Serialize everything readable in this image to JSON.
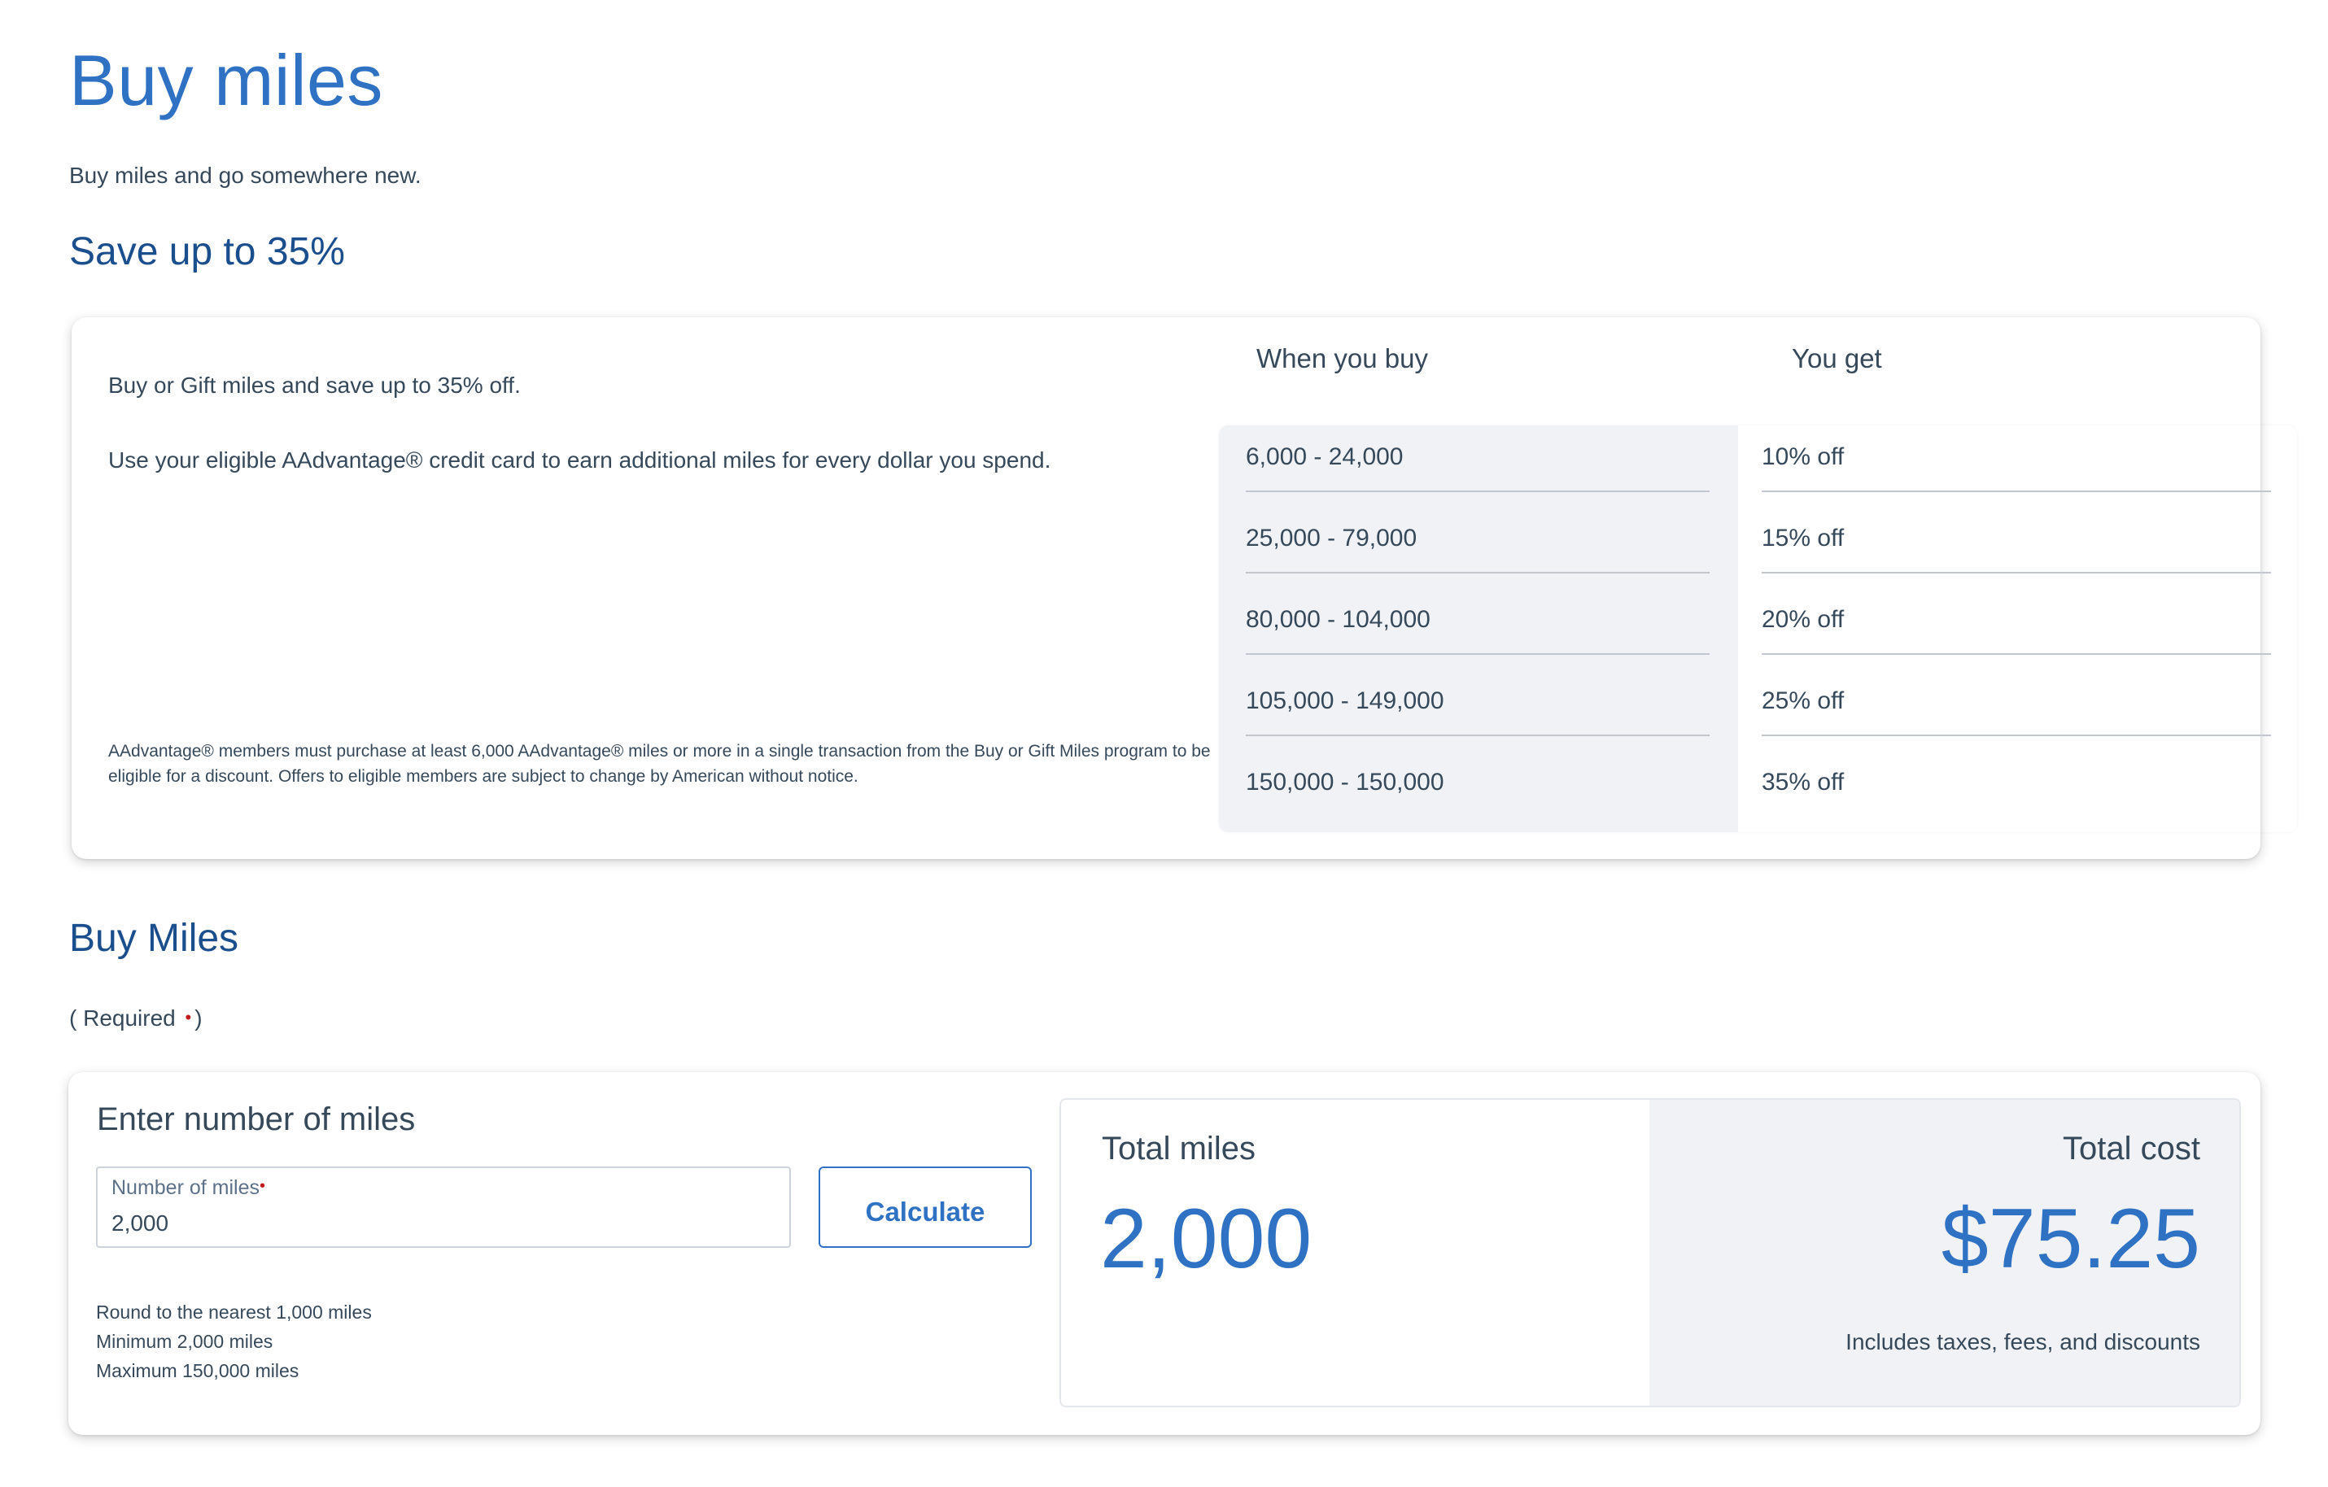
{
  "page": {
    "title": "Buy miles",
    "intro": "Buy miles and go somewhere new."
  },
  "save_section": {
    "heading": "Save up to 35%",
    "text1": "Buy or Gift miles and save up to 35% off.",
    "text2": "Use your eligible AAdvantage® credit card to earn additional miles for every dollar you spend.",
    "note": "AAdvantage® members must purchase at least 6,000 AAdvantage® miles or more in a single transaction from the Buy or Gift Miles program to be eligible for a discount. Offers to eligible members are subject to change by American without notice.",
    "col_buy": "When you buy",
    "col_get": "You get",
    "tiers": [
      {
        "range": "6,000 - 24,000",
        "discount": "10% off"
      },
      {
        "range": "25,000 - 79,000",
        "discount": "15% off"
      },
      {
        "range": "80,000 - 104,000",
        "discount": "20% off"
      },
      {
        "range": "105,000 - 149,000",
        "discount": "25% off"
      },
      {
        "range": "150,000 - 150,000",
        "discount": "35% off"
      }
    ]
  },
  "buy_section": {
    "heading": "Buy Miles",
    "required_open": "( Required",
    "required_dot": "•",
    "required_close": ")",
    "enter_title": "Enter number of miles",
    "field_label": "Number of miles",
    "field_dot": "•",
    "field_value": "2,000",
    "calculate_label": "Calculate",
    "hints": [
      "Round to the nearest 1,000 miles",
      "Minimum 2,000 miles",
      "Maximum 150,000 miles"
    ],
    "total_miles_label": "Total miles",
    "total_miles_value": "2,000",
    "total_cost_label": "Total cost",
    "total_cost_value": "$75.25",
    "total_cost_note": "Includes taxes, fees, and discounts"
  },
  "colors": {
    "accent_blue": "#2f72c4",
    "heading_navy": "#1a4e8c",
    "required_red": "#c21b1b",
    "panel_gray": "#f1f2f5"
  }
}
